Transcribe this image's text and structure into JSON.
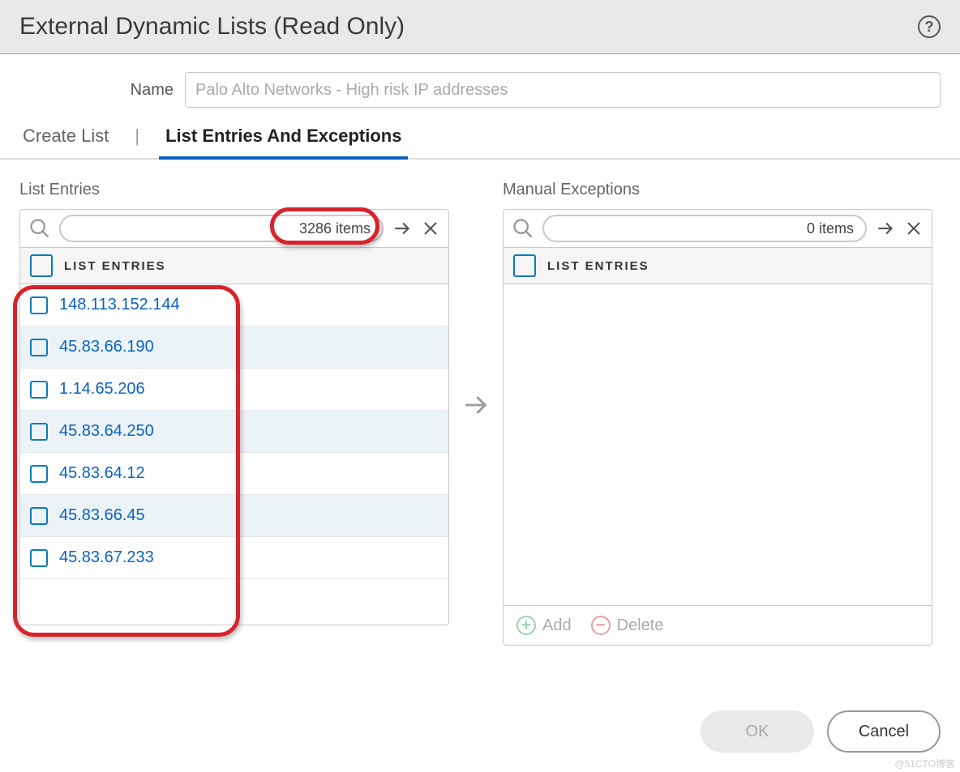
{
  "header": {
    "title": "External Dynamic Lists (Read Only)",
    "help_icon": "?"
  },
  "name_field": {
    "label": "Name",
    "value": "Palo Alto Networks - High risk IP addresses"
  },
  "tabs": {
    "create": "Create List",
    "separator": "|",
    "entries": "List Entries And Exceptions",
    "active": "entries"
  },
  "left": {
    "label": "List Entries",
    "count_text": "3286 items",
    "column": "LIST ENTRIES",
    "rows": [
      "148.113.152.144",
      "45.83.66.190",
      "1.14.65.206",
      "45.83.64.250",
      "45.83.64.12",
      "45.83.66.45",
      "45.83.67.233"
    ]
  },
  "right": {
    "label": "Manual Exceptions",
    "count_text": "0 items",
    "column": "LIST ENTRIES",
    "add": "Add",
    "delete": "Delete"
  },
  "buttons": {
    "ok": "OK",
    "cancel": "Cancel"
  },
  "watermark": "@51CTO博客"
}
